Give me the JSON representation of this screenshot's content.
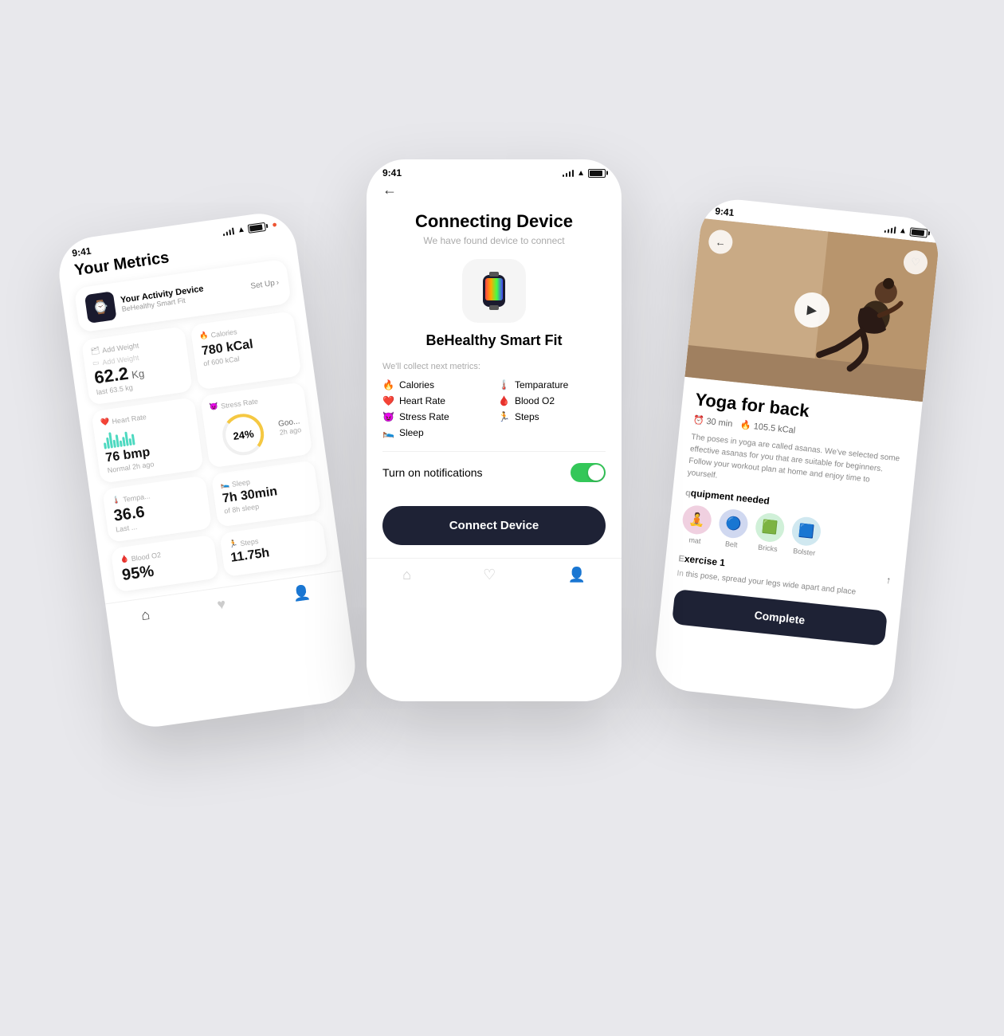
{
  "page": {
    "background": "#e8e8ec"
  },
  "left_phone": {
    "status_time": "9:41",
    "title": "Your Metrics",
    "activity_device": {
      "label": "Your Activity Device",
      "name": "BeHealthy Smart Fit",
      "setup_btn": "Set Up"
    },
    "weight_card": {
      "label": "Add Weight",
      "unit": "Kg",
      "value": "62.2",
      "sub": "last 63.5 kg"
    },
    "calories_card": {
      "label": "Calories",
      "value": "780 kCal",
      "sub": "of 600 kCal"
    },
    "heart_card": {
      "label": "Heart Rate",
      "value": "76 bmp",
      "sub": "Normal  2h ago"
    },
    "stress_card": {
      "label": "Stress Rate",
      "value": "24%",
      "sub": "Goo...",
      "time": "2h ago"
    },
    "temp_card": {
      "label": "Tempa...",
      "value": "36.6",
      "sub": "Last ..."
    },
    "sleep_card": {
      "label": "Sleep",
      "value": "7h 30min",
      "sub": "of 8h sleep"
    },
    "blood_card": {
      "label": "Blood O2",
      "value": "95%"
    },
    "steps_card": {
      "label": "Steps",
      "value": "11.75h"
    }
  },
  "center_phone": {
    "status_time": "9:41",
    "back_btn": "←",
    "title": "Connecting Device",
    "subtitle": "We have found device to connect",
    "device_name": "BeHealthy Smart Fit",
    "collect_label": "We'll collect next metrics:",
    "metrics": [
      {
        "icon": "🔥",
        "label": "Calories"
      },
      {
        "icon": "🌡️",
        "label": "Temparature"
      },
      {
        "icon": "❤️",
        "label": "Heart Rate"
      },
      {
        "icon": "🩸",
        "label": "Blood O2"
      },
      {
        "icon": "😈",
        "label": "Stress Rate"
      },
      {
        "icon": "🏃",
        "label": "Steps"
      },
      {
        "icon": "🛌",
        "label": "Sleep"
      },
      {
        "icon": "",
        "label": ""
      }
    ],
    "notification_label": "Turn on notifications",
    "connect_btn": "Connect Device"
  },
  "right_phone": {
    "status_time": "9:41",
    "back_btn": "←",
    "workout_title": "Yoga for back",
    "duration": "30 min",
    "calories": "105.5 kCal",
    "description": "The poses in yoga are called asanas. We've selected some effective asanas for you that are suitable for beginners. Follow your workout plan at home and enjoy time to yourself.",
    "equipment_title": "quipment needed",
    "equipment": [
      {
        "icon": "🧘",
        "label": "mat"
      },
      {
        "icon": "🔵",
        "label": "Belt"
      },
      {
        "icon": "🟩",
        "label": "Bricks"
      },
      {
        "icon": "🟦",
        "label": "Bolster"
      }
    ],
    "exercise_title": "xercise 1",
    "exercise_desc": "this pose, spread your legs wide apart and place",
    "complete_btn": "Complete"
  }
}
